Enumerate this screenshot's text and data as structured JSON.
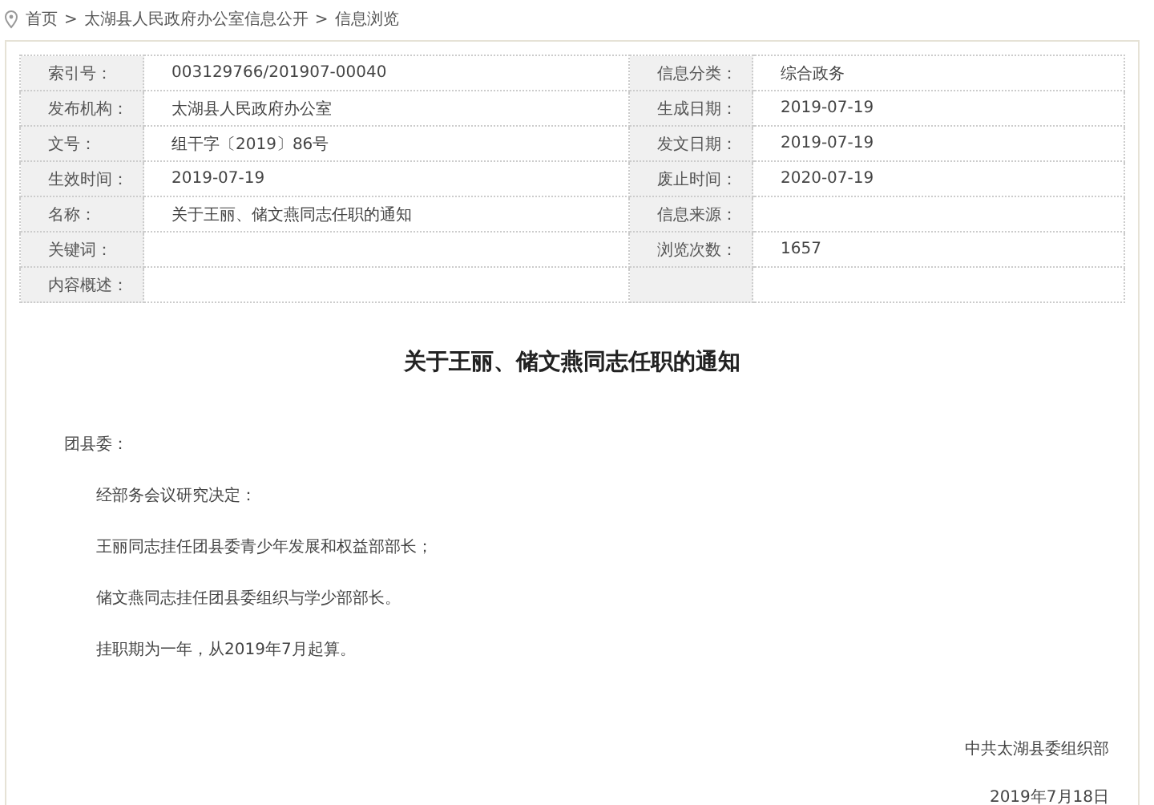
{
  "breadcrumb": [
    "首页",
    ">",
    "太湖县人民政府办公室信息公开",
    ">",
    "信息浏览"
  ],
  "meta_table": {
    "rows": [
      {
        "label": "索引号：",
        "value": "003129766/201907-00040",
        "label_2": "信息分类：",
        "value_2": "综合政务"
      },
      {
        "label": "发布机构：",
        "value": "太湖县人民政府办公室",
        "label_2": "生成日期：",
        "value_2": "2019-07-19"
      },
      {
        "label": "文号：",
        "value": "组干字〔2019〕86号",
        "label_2": "发文日期：",
        "value_2": "2019-07-19"
      },
      {
        "label": "生效时间：",
        "value": "2019-07-19",
        "label_2": "废止时间：",
        "value_2": "2020-07-19"
      },
      {
        "label": "名称：",
        "value": "关于王丽、储文燕同志任职的通知",
        "label_2": "信息来源："
      },
      {
        "label": "关键词：",
        "label_2": "浏览次数：",
        "value_2": "1657"
      },
      {
        "label": "内容概述："
      }
    ]
  },
  "article": {
    "title": "关于王丽、储文燕同志任职的通知",
    "salutation": "团县委：",
    "paragraphs": [
      "经部务会议研究决定：",
      "王丽同志挂任团县委青少年发展和权益部部长；",
      "储文燕同志挂任团县委组织与学少部部长。",
      "挂职期为一年，从2019年7月起算。"
    ],
    "signature": "中共太湖县委组织部",
    "date": "2019年7月18日"
  }
}
